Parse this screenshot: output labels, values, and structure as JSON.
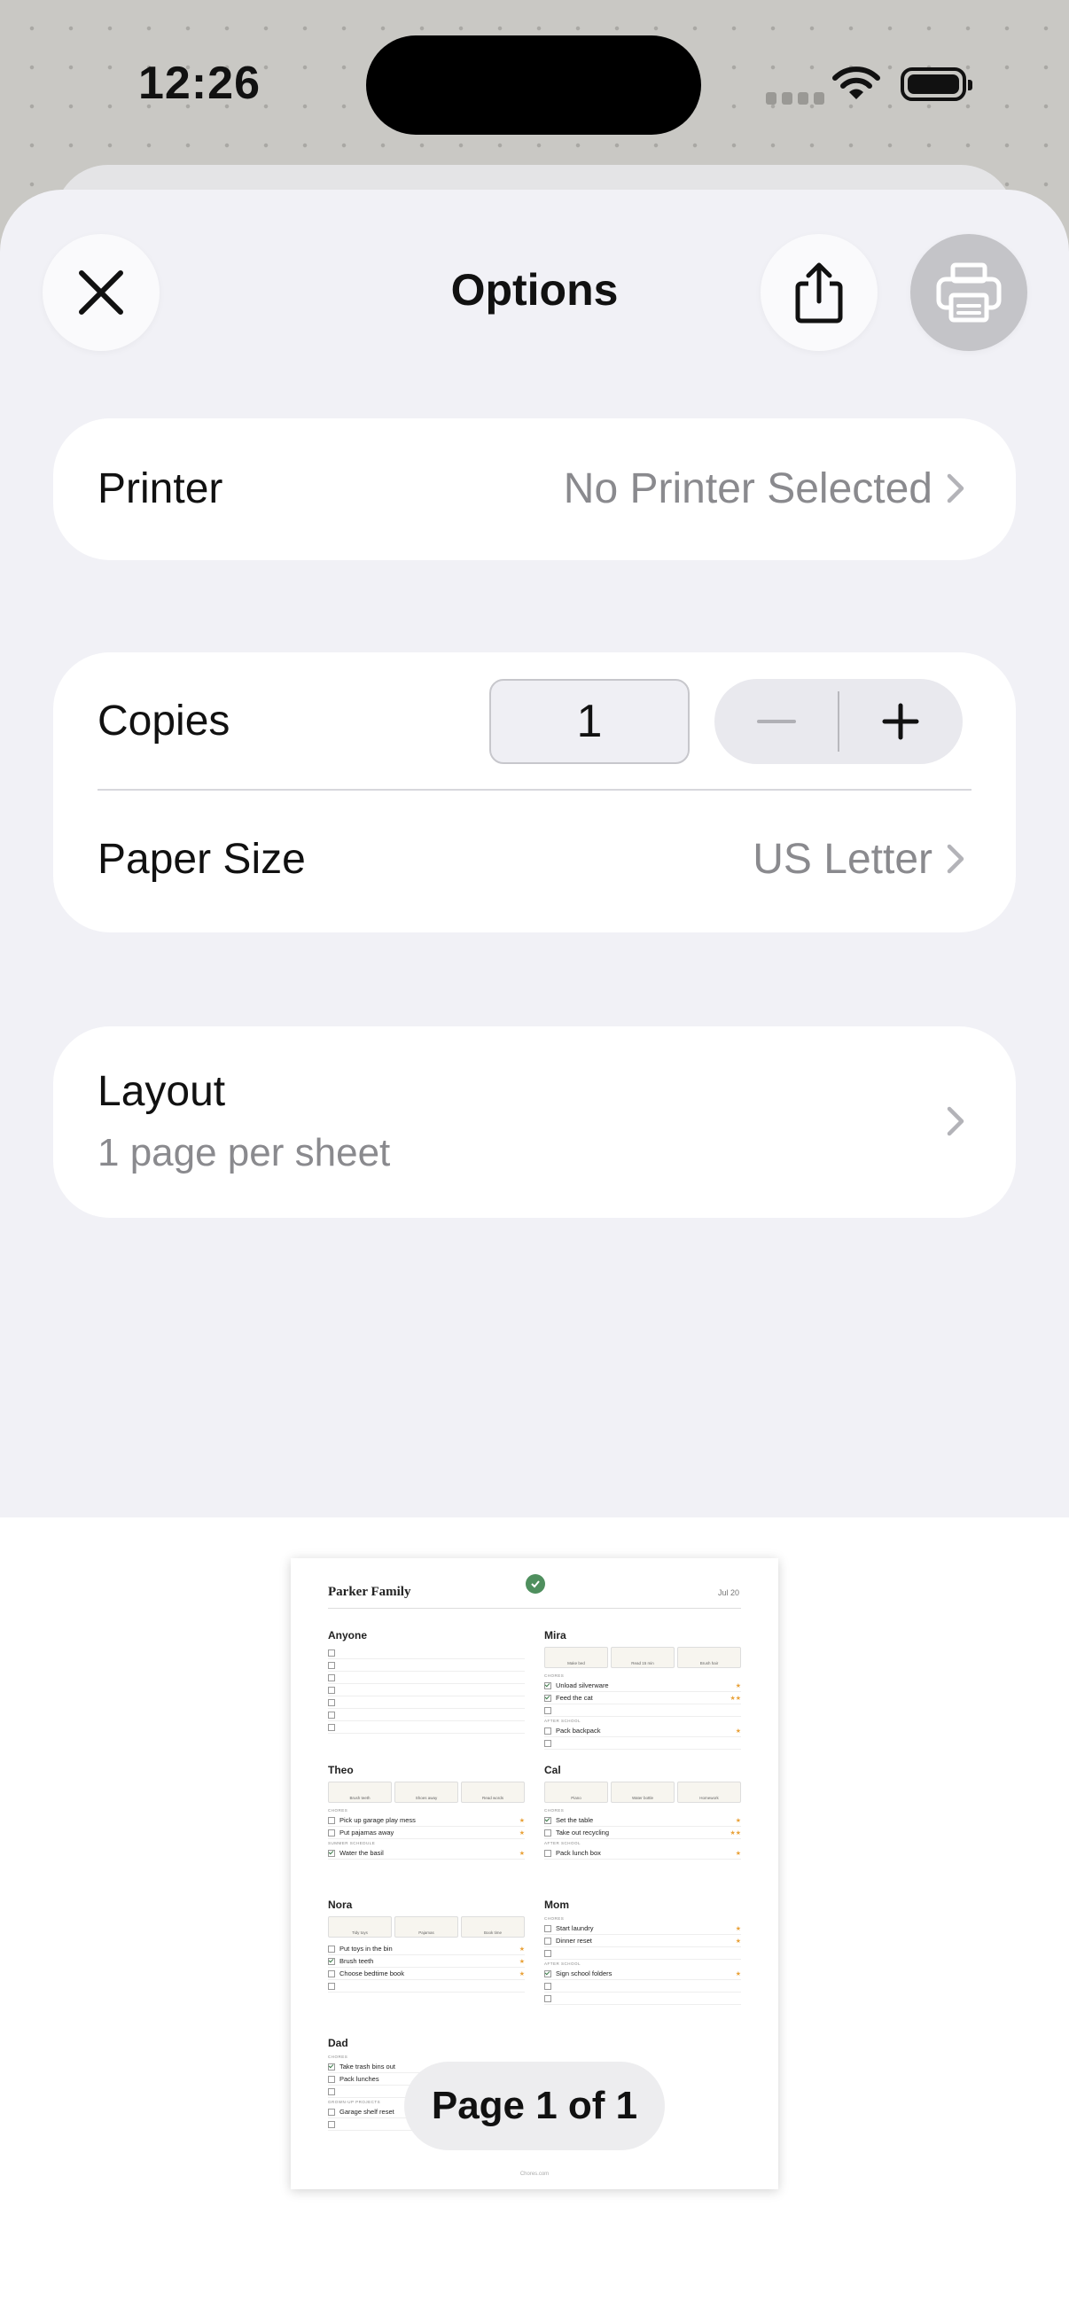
{
  "status_bar": {
    "time": "12:26"
  },
  "header": {
    "title": "Options"
  },
  "printer": {
    "label": "Printer",
    "value": "No Printer Selected"
  },
  "copies": {
    "label": "Copies",
    "value": "1"
  },
  "paper_size": {
    "label": "Paper Size",
    "value": "US Letter"
  },
  "layout": {
    "label": "Layout",
    "value": "1 page per sheet"
  },
  "preview": {
    "page_indicator": "Page 1 of 1",
    "doc": {
      "title": "Parker Family",
      "date": "Jul 20",
      "footer": "Chores.com",
      "sections": {
        "anyone": {
          "name": "Anyone"
        },
        "mira": {
          "name": "Mira",
          "routines": [
            "Make bed",
            "Read 15 min",
            "Brush hair"
          ],
          "chores_cap": "CHORES",
          "chores": [
            "Unload silverware",
            "Feed the cat"
          ],
          "after_cap": "AFTER SCHOOL",
          "after": [
            "Pack backpack"
          ]
        },
        "theo": {
          "name": "Theo",
          "routines": [
            "Brush teeth",
            "Shoes away",
            "Read words"
          ],
          "chores_cap": "CHORES",
          "chores": [
            "Pick up garage play mess",
            "Put pajamas away"
          ],
          "summer_cap": "SUMMER SCHEDULE",
          "summer": [
            "Water the basil"
          ]
        },
        "cal": {
          "name": "Cal",
          "routines": [
            "Piano",
            "Water bottle",
            "Homework"
          ],
          "chores_cap": "CHORES",
          "chores": [
            "Set the table",
            "Take out recycling"
          ],
          "after_cap": "AFTER SCHOOL",
          "after": [
            "Pack lunch box"
          ]
        },
        "nora": {
          "name": "Nora",
          "routines": [
            "Tidy toys",
            "Pajamas",
            "Book time"
          ],
          "chores": [
            "Put toys in the bin",
            "Brush teeth",
            "Choose bedtime book"
          ]
        },
        "mom": {
          "name": "Mom",
          "chores_cap": "CHORES",
          "chores": [
            "Start laundry",
            "Dinner reset"
          ],
          "after_cap": "AFTER SCHOOL",
          "after": [
            "Sign school folders"
          ]
        },
        "dad": {
          "name": "Dad",
          "chores_cap": "CHORES",
          "chores": [
            "Take trash bins out",
            "Pack lunches"
          ],
          "grown_cap": "GROWN-UP PROJECTS",
          "grown": [
            "Garage shelf reset"
          ]
        }
      }
    }
  }
}
